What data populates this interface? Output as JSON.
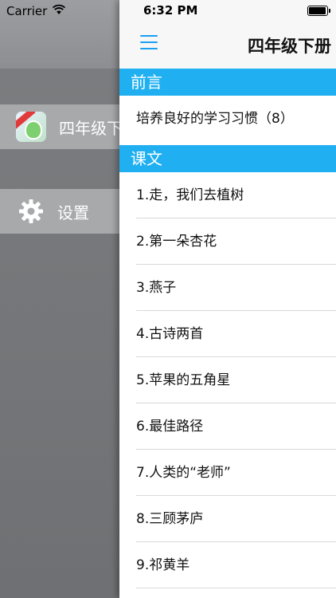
{
  "status_bar": {
    "carrier": "Carrier",
    "time": "6:32 PM"
  },
  "drawer": {
    "items": [
      {
        "label": "四年级下册",
        "icon": "app-icon"
      },
      {
        "label": "设置",
        "icon": "gear-icon"
      }
    ]
  },
  "navbar": {
    "title": "四年级下册",
    "menu_icon": "hamburger-menu-icon"
  },
  "sections": [
    {
      "header": "前言",
      "rows": [
        "培养良好的学习习惯（8）"
      ]
    },
    {
      "header": "课文",
      "rows": [
        "1.走，我们去植树",
        "2.第一朵杏花",
        "3.燕子",
        "4.古诗两首",
        "5.苹果的五角星",
        "6.最佳路径",
        "7.人类的“老师”",
        "8.三顾茅庐",
        "9.祁黄羊"
      ]
    }
  ],
  "colors": {
    "accent": "#1a9ff2",
    "section_header": "#20b0f2"
  }
}
